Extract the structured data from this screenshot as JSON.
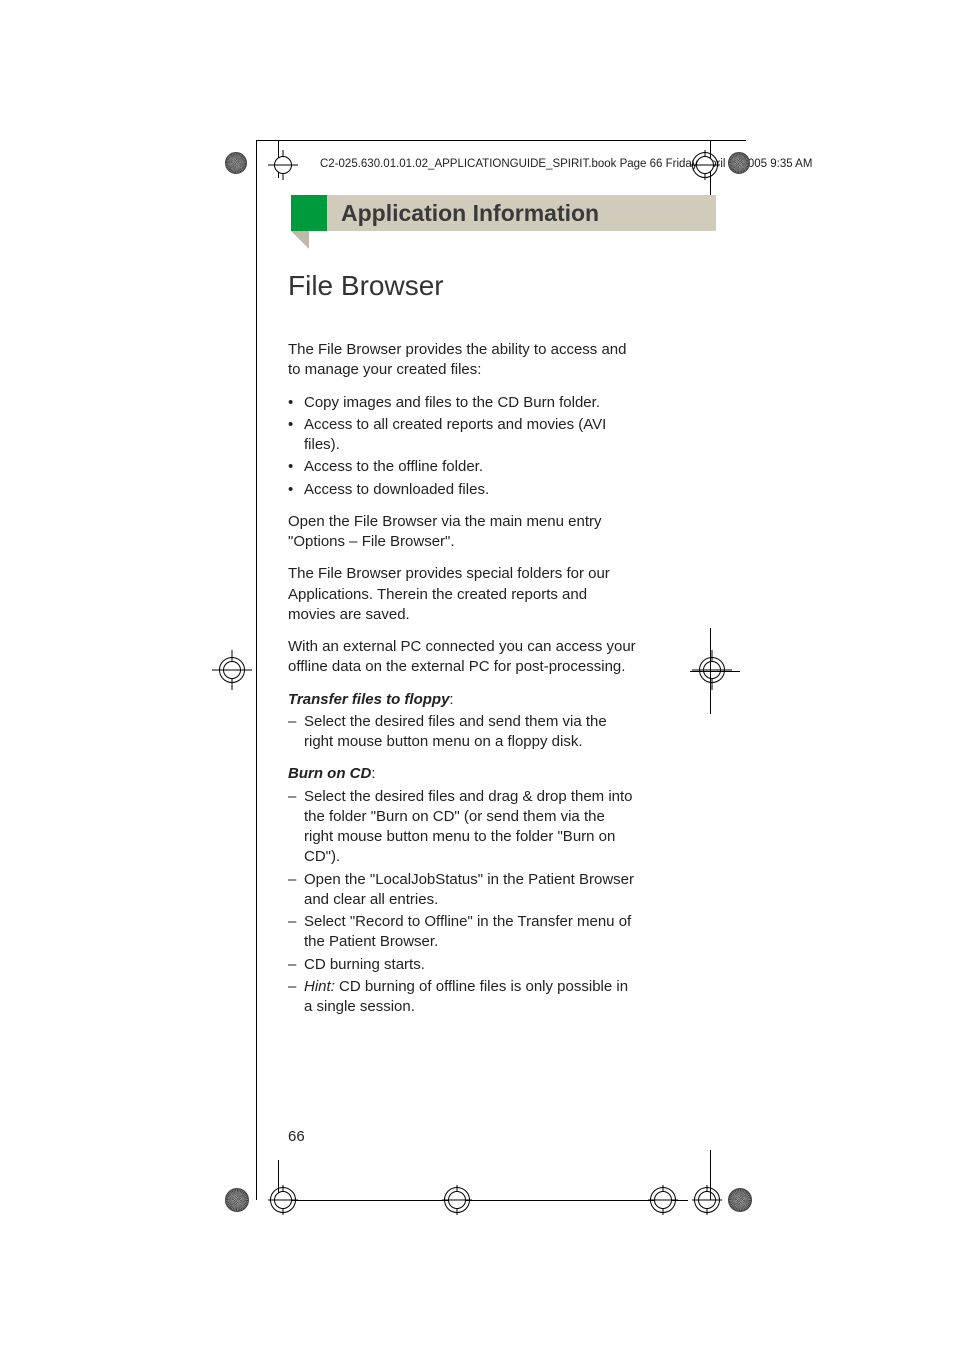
{
  "header_line": "C2-025.630.01.01.02_APPLICATIONGUIDE_SPIRIT.book  Page 66  Friday, April 8, 2005  9:35 AM",
  "band_title": "Application Information",
  "heading": "File Browser",
  "intro": "The File Browser provides the ability to access and to manage your created files:",
  "bullets": [
    "Copy images and files to the CD Burn folder.",
    "Access to all created reports and movies (AVI files).",
    "Access to the offline folder.",
    "Access to downloaded files."
  ],
  "para_open": "Open the File Browser via the main menu entry \"Options – File Browser\".",
  "para_folders": "The File Browser provides special folders for our Applications. Therein the created reports and movies are saved.",
  "para_external": "With an external PC connected you can access your offline data on the external PC for post-processing.",
  "transfer_label": "Transfer files to floppy",
  "transfer_items": [
    "Select the desired files and send them via the right mouse button menu on a floppy disk."
  ],
  "burn_label": "Burn on CD",
  "burn_items": [
    "Select the desired files and drag & drop them into the folder \"Burn on CD\" (or send them via the right mouse button menu to the folder \"Burn on CD\").",
    "Open the \"LocalJobStatus\" in the Patient Browser and clear all entries.",
    "Select \"Record to Offline\" in the Transfer menu of the Patient Browser.",
    "CD burning starts."
  ],
  "hint_prefix": "Hint:",
  "hint_text": " CD burning of offline files is only possible in a single session.",
  "page_number": "66"
}
